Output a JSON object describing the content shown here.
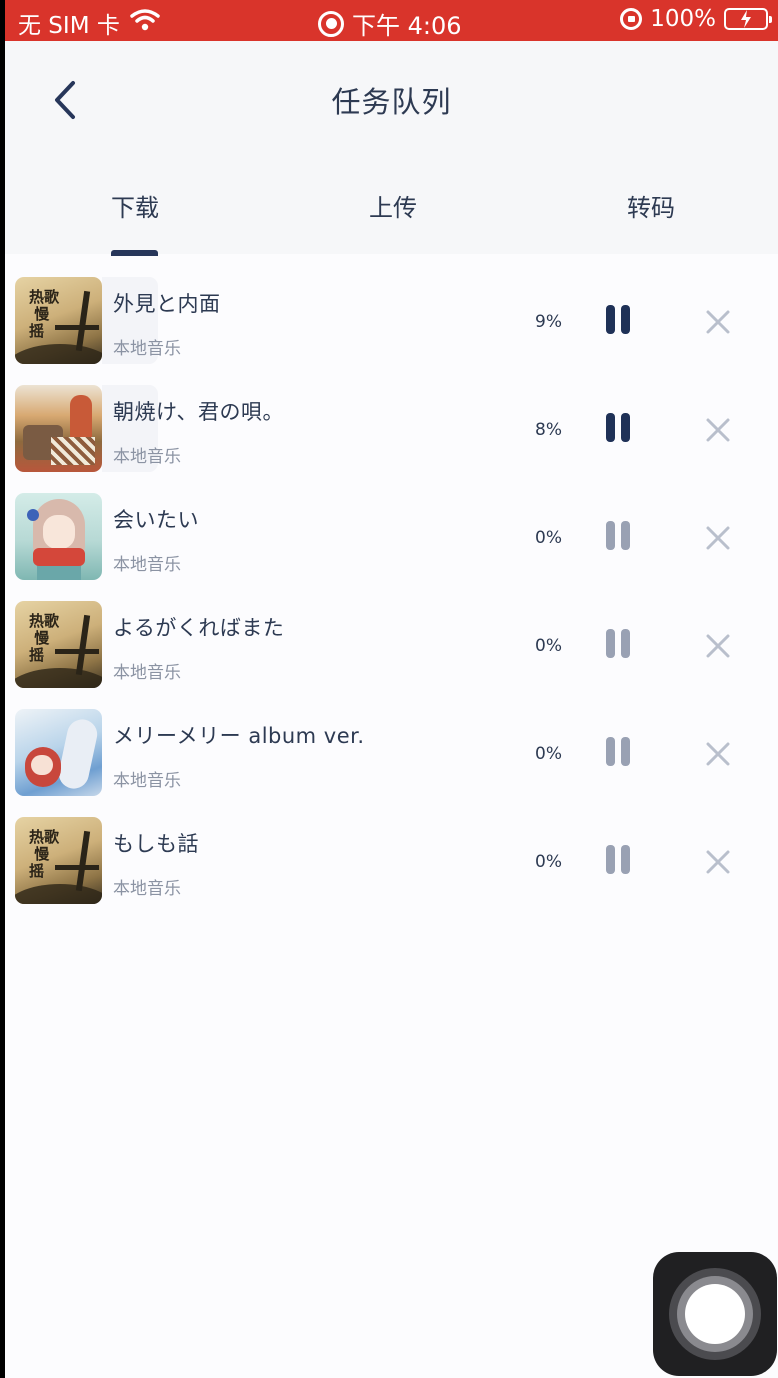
{
  "status_bar": {
    "carrier": "无 SIM 卡",
    "time": "下午 4:06",
    "battery": "100%",
    "accent": "#d9342b"
  },
  "header": {
    "title": "任务队列",
    "back_icon": "chevron-left-icon"
  },
  "tabs": [
    {
      "label": "下载",
      "active": true
    },
    {
      "label": "上传",
      "active": false
    },
    {
      "label": "转码",
      "active": false
    }
  ],
  "tasks": [
    {
      "title": "外見と内面",
      "source": "本地音乐",
      "progress": "9%",
      "cover": "old-record",
      "active": true
    },
    {
      "title": "朝焼け、君の唄。",
      "source": "本地音乐",
      "progress": "8%",
      "cover": "anime-cafe",
      "active": true
    },
    {
      "title": "会いたい",
      "source": "本地音乐",
      "progress": "0%",
      "cover": "anime-girl-scarf",
      "active": false
    },
    {
      "title": "よるがくればまた",
      "source": "本地音乐",
      "progress": "0%",
      "cover": "old-record",
      "active": false
    },
    {
      "title": "メリーメリー album ver.",
      "source": "本地音乐",
      "progress": "0%",
      "cover": "anime-blue",
      "active": false
    },
    {
      "title": "もしも話",
      "source": "本地音乐",
      "progress": "0%",
      "cover": "old-record",
      "active": false
    }
  ],
  "cover_text": {
    "old_record": "热歌\n慢\n摇"
  },
  "colors": {
    "primary_text": "#2d3a52",
    "secondary_text": "#8b93a3",
    "pause_active": "#1f3157",
    "pause_inactive": "#99a1b3",
    "close_icon": "#b9bfcc"
  }
}
